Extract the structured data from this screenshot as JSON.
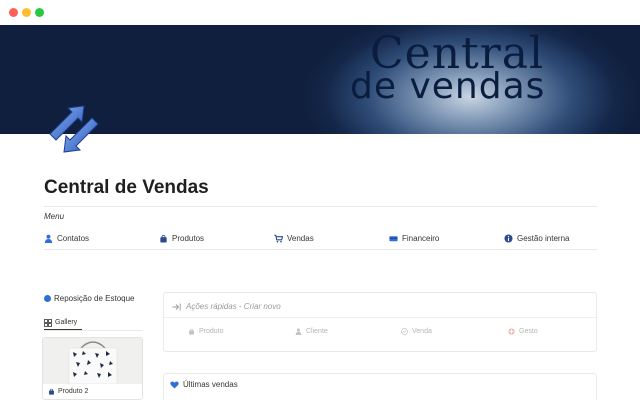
{
  "window": {
    "controls": [
      "close",
      "minimize",
      "maximize"
    ]
  },
  "cover": {
    "line1": "Central",
    "line2": "de vendas"
  },
  "page": {
    "title": "Central de Vendas",
    "icon": "two-blue-arrows-icon"
  },
  "menu": {
    "label": "Menu",
    "items": [
      {
        "label": "Contatos",
        "icon": "person-icon"
      },
      {
        "label": "Produtos",
        "icon": "shopping-bag-icon"
      },
      {
        "label": "Vendas",
        "icon": "cart-icon"
      },
      {
        "label": "Financeiro",
        "icon": "money-icon"
      },
      {
        "label": "Gestão interna",
        "icon": "info-icon"
      }
    ]
  },
  "inventory": {
    "title": "Reposição de Estoque",
    "view_tab": "Gallery",
    "cards": [
      {
        "label": "Produto 2"
      }
    ]
  },
  "quick_actions": {
    "title": "Ações rápidas - Criar novo",
    "buttons": [
      {
        "label": "Produto",
        "icon": "bag-icon"
      },
      {
        "label": "Cliente",
        "icon": "person-icon"
      },
      {
        "label": "Venda",
        "icon": "cart-icon"
      },
      {
        "label": "Gesto",
        "icon": "emergency-icon"
      }
    ]
  },
  "latest_sales": {
    "title": "Últimas vendas",
    "icon": "blue-heart-icon"
  },
  "colors": {
    "accent_blue": "#2f6fd6",
    "cover_dark": "#0f1f3d",
    "text": "#37352f",
    "muted": "#9b9a97"
  }
}
